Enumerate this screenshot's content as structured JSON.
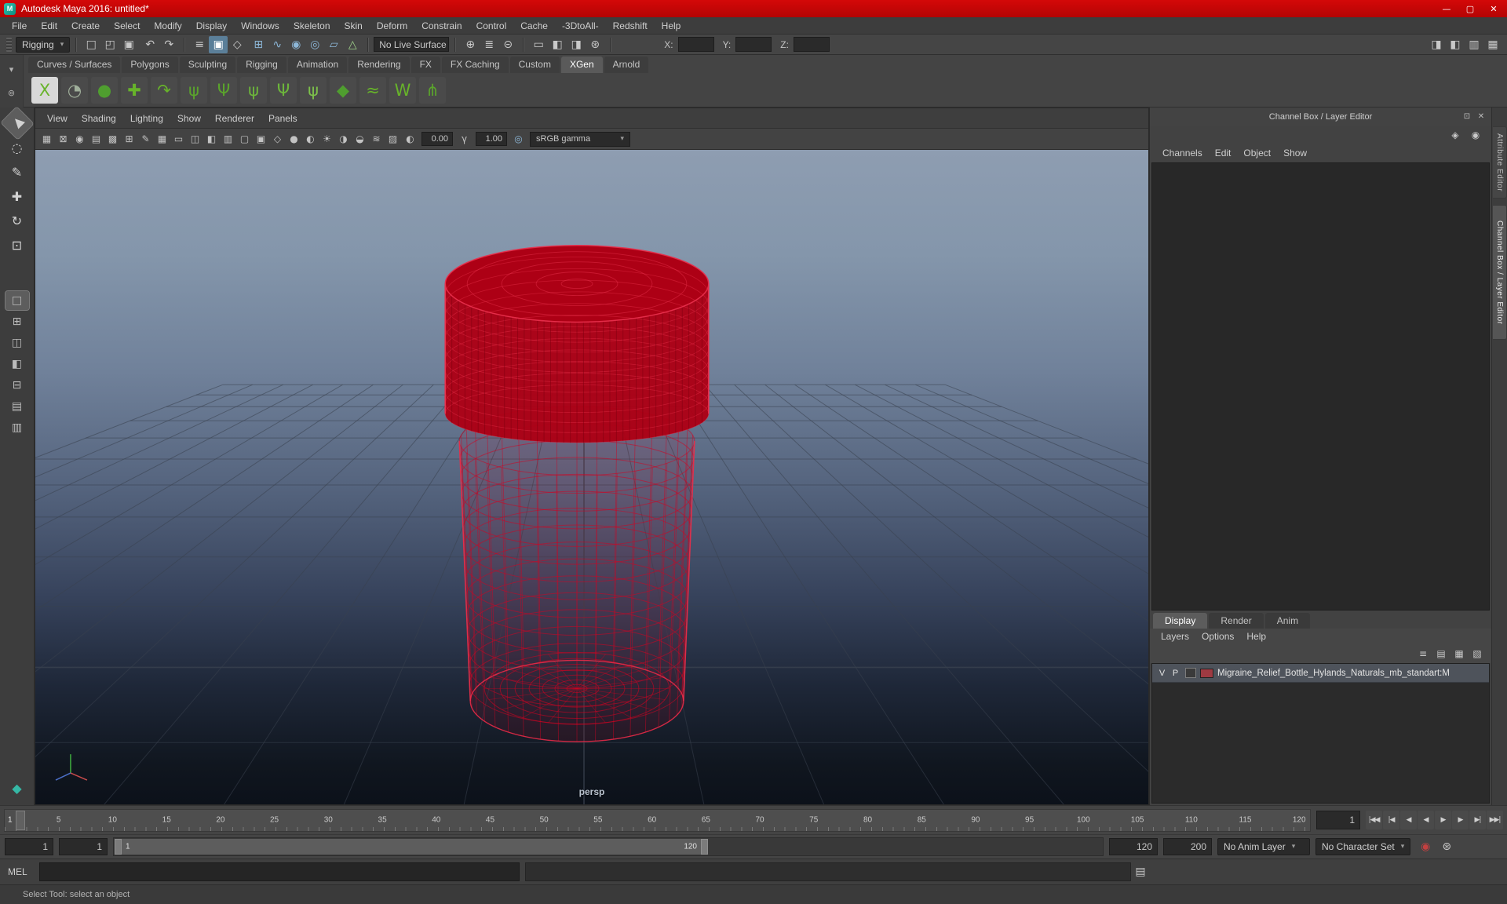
{
  "window": {
    "title": "Autodesk Maya 2016: untitled*",
    "logo": "M",
    "minimize": "—",
    "maximize": "▢",
    "close": "✕"
  },
  "menu_bar": [
    "File",
    "Edit",
    "Create",
    "Select",
    "Modify",
    "Display",
    "Windows",
    "Skeleton",
    "Skin",
    "Deform",
    "Constrain",
    "Control",
    "Cache",
    "-3DtoAll-",
    "Redshift",
    "Help"
  ],
  "status_line": {
    "menu_set": "Rigging",
    "file_icons": [
      {
        "name": "new-scene-icon",
        "glyph": "□"
      },
      {
        "name": "open-scene-icon",
        "glyph": "◰"
      },
      {
        "name": "save-scene-icon",
        "glyph": "▣"
      }
    ],
    "undo_icons": [
      {
        "name": "undo-icon",
        "glyph": "↶"
      },
      {
        "name": "redo-icon",
        "glyph": "↷"
      }
    ],
    "selection_icons": [
      {
        "name": "select-hierarchy-icon",
        "glyph": "≡"
      },
      {
        "name": "select-object-icon",
        "glyph": "▣",
        "active": true
      },
      {
        "name": "select-component-icon",
        "glyph": "◇"
      }
    ],
    "snap_icons": [
      {
        "name": "snap-grid-icon",
        "glyph": "⊞",
        "fg": "#8db7d8"
      },
      {
        "name": "snap-curve-icon",
        "glyph": "∿",
        "fg": "#8db7d8"
      },
      {
        "name": "snap-point-icon",
        "glyph": "◉",
        "fg": "#8db7d8"
      },
      {
        "name": "snap-projected-center-icon",
        "glyph": "◎",
        "fg": "#8db7d8"
      },
      {
        "name": "snap-view-plane-icon",
        "glyph": "▱",
        "fg": "#8db7d8"
      },
      {
        "name": "make-live-icon",
        "glyph": "△",
        "fg": "#9fd08a"
      }
    ],
    "live_surface_label": "No Live Surface",
    "history_icons": [
      {
        "name": "input-connections-icon",
        "glyph": "⊕"
      },
      {
        "name": "construction-history-icon",
        "glyph": "≣"
      },
      {
        "name": "output-connections-icon",
        "glyph": "⊝"
      }
    ],
    "render_icons": [
      {
        "name": "open-render-view-icon",
        "glyph": "▭"
      },
      {
        "name": "render-current-frame-icon",
        "glyph": "◧"
      },
      {
        "name": "ipr-render-icon",
        "glyph": "◨"
      },
      {
        "name": "render-settings-icon",
        "glyph": "⊛"
      }
    ],
    "x_label": "X:",
    "y_label": "Y:",
    "z_label": "Z:",
    "coord_x": "",
    "coord_y": "",
    "coord_z": "",
    "right_icons": [
      {
        "name": "attribute-editor-toggle-icon",
        "glyph": "◨"
      },
      {
        "name": "tool-settings-toggle-icon",
        "glyph": "◧"
      },
      {
        "name": "channel-box-toggle-icon",
        "glyph": "▥"
      },
      {
        "name": "workspace-toggle-icon",
        "glyph": "▦"
      }
    ]
  },
  "shelf": {
    "left_icons": [
      {
        "name": "shelf-tab-menu-icon",
        "glyph": "▾"
      },
      {
        "name": "shelf-options-icon",
        "glyph": "⊚"
      }
    ],
    "tabs": [
      "Curves / Surfaces",
      "Polygons",
      "Sculpting",
      "Rigging",
      "Animation",
      "Rendering",
      "FX",
      "FX Caching",
      "Custom",
      "XGen",
      "Arnold"
    ],
    "active_tab": "XGen",
    "icons": [
      {
        "name": "xgen-editor-icon",
        "glyph": "X",
        "fg": "#67b32a",
        "bg": "#d8d8d8"
      },
      {
        "name": "xgen-description-icon",
        "glyph": "◔",
        "fg": "#9fae9a"
      },
      {
        "name": "xgen-sphere-icon",
        "glyph": "●",
        "fg": "#4f9e2f"
      },
      {
        "name": "xgen-add-description-icon",
        "glyph": "✚",
        "fg": "#67b32a"
      },
      {
        "name": "xgen-export-selection-icon",
        "glyph": "↷",
        "fg": "#67b32a"
      },
      {
        "name": "xgen-grass-icon",
        "glyph": "ψ",
        "fg": "#5aa32c"
      },
      {
        "name": "xgen-grass-add-icon",
        "glyph": "Ψ",
        "fg": "#5aa32c"
      },
      {
        "name": "xgen-guides-icon",
        "glyph": "ψ",
        "fg": "#6cb53b"
      },
      {
        "name": "xgen-lock-guides-icon",
        "glyph": "Ψ",
        "fg": "#6cb53b"
      },
      {
        "name": "xgen-straight-guides-icon",
        "glyph": "ψ",
        "fg": "#7cc04a"
      },
      {
        "name": "xgen-patch-export-icon",
        "glyph": "◆",
        "fg": "#4f9e2f"
      },
      {
        "name": "xgen-curves-to-guides-icon",
        "glyph": "≈",
        "fg": "#67b32a"
      },
      {
        "name": "xgen-width-ramp-icon",
        "glyph": "W",
        "fg": "#67b32a"
      },
      {
        "name": "xgen-comb-icon",
        "glyph": "⋔",
        "fg": "#5aa32c"
      }
    ]
  },
  "toolbox": {
    "tools": [
      {
        "name": "select-tool-icon",
        "glyph": "▶",
        "rot": -135,
        "active": true
      },
      {
        "name": "lasso-tool-icon",
        "glyph": "◌"
      },
      {
        "name": "paint-select-tool-icon",
        "glyph": "✎"
      },
      {
        "name": "move-tool-icon",
        "glyph": "✚"
      },
      {
        "name": "rotate-tool-icon",
        "glyph": "↻"
      },
      {
        "name": "scale-tool-icon",
        "glyph": "⊡"
      }
    ],
    "layouts": [
      {
        "name": "single-pane-layout-icon",
        "glyph": "□",
        "active": true
      },
      {
        "name": "four-pane-layout-icon",
        "glyph": "⊞"
      },
      {
        "name": "persp-outliner-layout-icon",
        "glyph": "◫"
      },
      {
        "name": "two-pane-side-layout-icon",
        "glyph": "◧"
      },
      {
        "name": "two-pane-stacked-layout-icon",
        "glyph": "⊟"
      },
      {
        "name": "persp-graph-layout-icon",
        "glyph": "▤"
      },
      {
        "name": "hypershade-persp-layout-icon",
        "glyph": "▥"
      }
    ],
    "plugin_icon": [
      {
        "name": "xgen-plugin-icon",
        "glyph": "◆",
        "fg": "#35b8a5"
      }
    ]
  },
  "viewport": {
    "menus": [
      "View",
      "Shading",
      "Lighting",
      "Show",
      "Renderer",
      "Panels"
    ],
    "toolbar_icons": [
      {
        "name": "select-camera-icon",
        "glyph": "▦"
      },
      {
        "name": "lock-camera-icon",
        "glyph": "⊠"
      },
      {
        "name": "camera-attributes-icon",
        "glyph": "◉"
      },
      {
        "name": "bookmarks-icon",
        "glyph": "▤"
      },
      {
        "name": "image-plane-icon",
        "glyph": "▩"
      },
      {
        "name": "2d-pan-zoom-icon",
        "glyph": "⊞"
      },
      {
        "name": "grease-pencil-icon",
        "glyph": "✎"
      },
      {
        "name": "grid-icon",
        "glyph": "▦"
      },
      {
        "name": "film-gate-icon",
        "glyph": "▭"
      },
      {
        "name": "resolution-gate-icon",
        "glyph": "◫"
      },
      {
        "name": "gate-mask-icon",
        "glyph": "◧"
      },
      {
        "name": "field-chart-icon",
        "glyph": "▥"
      },
      {
        "name": "safe-action-icon",
        "glyph": "▢"
      },
      {
        "name": "safe-title-icon",
        "glyph": "▣"
      },
      {
        "name": "wireframe-icon",
        "glyph": "◇"
      },
      {
        "name": "shaded-icon",
        "glyph": "●"
      },
      {
        "name": "textured-icon",
        "glyph": "◐"
      },
      {
        "name": "lights-icon",
        "glyph": "☀"
      },
      {
        "name": "shadows-icon",
        "glyph": "◑"
      },
      {
        "name": "ao-icon",
        "glyph": "◒"
      },
      {
        "name": "motion-blur-icon",
        "glyph": "≋"
      },
      {
        "name": "xray-icon",
        "glyph": "▨"
      }
    ],
    "exposure_icon": [
      {
        "name": "exposure-icon",
        "glyph": "◐"
      }
    ],
    "exposure_value": "0.00",
    "gamma_icon": [
      {
        "name": "gamma-icon",
        "glyph": "γ"
      }
    ],
    "gamma_value": "1.00",
    "cm_icon": [
      {
        "name": "color-management-icon",
        "glyph": "◎",
        "fg": "#8db7d8"
      }
    ],
    "view_transform": "sRGB gamma",
    "camera_label": "persp"
  },
  "channel_box": {
    "header": "Channel Box / Layer Editor",
    "window_icons": [
      {
        "name": "float-panel-icon",
        "glyph": "⊡"
      },
      {
        "name": "close-panel-icon",
        "glyph": "✕"
      }
    ],
    "pin_icons": [
      {
        "name": "manipulator-icon",
        "glyph": "◈"
      },
      {
        "name": "pin-channelbox-icon",
        "glyph": "◉"
      }
    ],
    "menus": [
      "Channels",
      "Edit",
      "Object",
      "Show"
    ]
  },
  "layer_editor": {
    "tabs": [
      "Display",
      "Render",
      "Anim"
    ],
    "active_tab": "Display",
    "menus": [
      "Layers",
      "Options",
      "Help"
    ],
    "toolbar_icons": [
      {
        "name": "sort-layers-icon",
        "glyph": "≡"
      },
      {
        "name": "empty-layer-icon",
        "glyph": "▤"
      },
      {
        "name": "layer-from-selected-icon",
        "glyph": "▦"
      },
      {
        "name": "layer-options-icon",
        "glyph": "▧"
      }
    ],
    "layers": [
      {
        "visibility": "V",
        "playback": "P",
        "name": "Migraine_Relief_Bottle_Hylands_Naturals_mb_standart:M",
        "color": "#9e3a42"
      }
    ]
  },
  "side_tabs": [
    {
      "label": "Attribute Editor",
      "active": false
    },
    {
      "label": "Channel Box / Layer Editor",
      "active": true
    }
  ],
  "time_slider": {
    "ticks": [
      5,
      10,
      15,
      20,
      25,
      30,
      35,
      40,
      45,
      50,
      55,
      60,
      65,
      70,
      75,
      80,
      85,
      90,
      95,
      100,
      105,
      110,
      115,
      120
    ],
    "current_frame": "1",
    "current_time": "1",
    "playback_buttons": [
      {
        "name": "go-to-start-button",
        "glyph": "|◀◀"
      },
      {
        "name": "step-back-frame-button",
        "glyph": "|◀"
      },
      {
        "name": "step-back-key-button",
        "glyph": "◀"
      },
      {
        "name": "play-backwards-button",
        "glyph": "◀"
      },
      {
        "name": "play-forwards-button",
        "glyph": "▶"
      },
      {
        "name": "step-forward-key-button",
        "glyph": "▶"
      },
      {
        "name": "step-forward-frame-button",
        "glyph": "▶|"
      },
      {
        "name": "go-to-end-button",
        "glyph": "▶▶|"
      }
    ]
  },
  "range_slider": {
    "anim_start": "1",
    "playback_start": "1",
    "range_start": "1",
    "range_end": "120",
    "playback_end": "120",
    "anim_end": "200",
    "anim_layer": "No Anim Layer",
    "character_set": "No Character Set",
    "icons": [
      {
        "name": "auto-keyframe-icon",
        "glyph": "◉",
        "fg": "#c34040"
      },
      {
        "name": "anim-preferences-icon",
        "glyph": "⊛"
      }
    ]
  },
  "command_line": {
    "label": "MEL",
    "input_value": "",
    "result_value": "",
    "icons": [
      {
        "name": "script-editor-icon",
        "glyph": "▤"
      }
    ]
  },
  "help_line": {
    "text": "Select Tool: select an object"
  },
  "colors": {
    "wireframe": "#cf0322",
    "wireframe_dark": "#7c000f",
    "wireframe_light": "#e8304c",
    "cap_fill": "#ad0015",
    "grid": "#39414e",
    "layer_swatch": "#9e3a42"
  }
}
